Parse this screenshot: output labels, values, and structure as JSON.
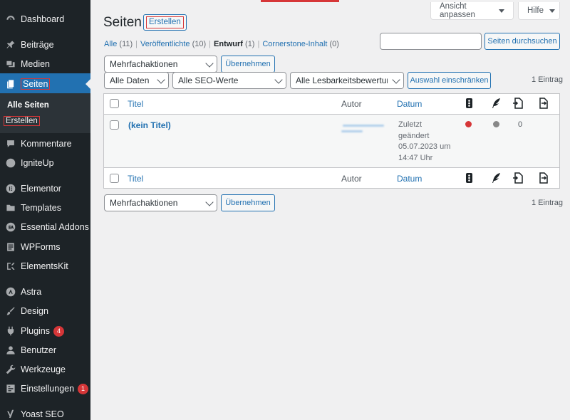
{
  "sidebar": {
    "items": [
      {
        "label": "Dashboard",
        "icon": "dashboard-icon"
      },
      {
        "label": "Beiträge",
        "icon": "pin-icon"
      },
      {
        "label": "Medien",
        "icon": "media-icon"
      },
      {
        "label": "Seiten",
        "icon": "pages-icon"
      },
      {
        "label": "Kommentare",
        "icon": "comment-icon"
      },
      {
        "label": "IgniteUp",
        "icon": "igniteup-icon"
      },
      {
        "label": "Elementor",
        "icon": "elementor-icon"
      },
      {
        "label": "Templates",
        "icon": "folder-icon"
      },
      {
        "label": "Essential Addons",
        "icon": "ea-icon"
      },
      {
        "label": "WPForms",
        "icon": "forms-icon"
      },
      {
        "label": "ElementsKit",
        "icon": "elementskit-icon"
      },
      {
        "label": "Astra",
        "icon": "astra-icon"
      },
      {
        "label": "Design",
        "icon": "brush-icon"
      },
      {
        "label": "Plugins",
        "icon": "plugin-icon",
        "badge": "4"
      },
      {
        "label": "Benutzer",
        "icon": "user-icon"
      },
      {
        "label": "Werkzeuge",
        "icon": "wrench-icon"
      },
      {
        "label": "Einstellungen",
        "icon": "settings-icon",
        "badge": "1"
      },
      {
        "label": "Yoast SEO",
        "icon": "yoast-icon"
      }
    ],
    "submenu": {
      "all_pages": "Alle Seiten",
      "create": "Erstellen"
    }
  },
  "screen_options": {
    "view": "Ansicht anpassen",
    "help": "Hilfe"
  },
  "header": {
    "title": "Seiten",
    "add_new": "Erstellen"
  },
  "views": {
    "all": "Alle",
    "all_count": "(11)",
    "published": "Veröffentlichte",
    "published_count": "(10)",
    "draft": "Entwurf",
    "draft_count": "(1)",
    "cornerstone": "Cornerstone-Inhalt",
    "cornerstone_count": "(0)"
  },
  "search": {
    "button": "Seiten durchsuchen",
    "placeholder": ""
  },
  "bulk": {
    "select": "Mehrfachaktionen",
    "apply": "Übernehmen"
  },
  "filters": {
    "dates": "Alle Daten",
    "seo": "Alle SEO-Werte",
    "readability": "Alle Lesbarkeitsbewertungen",
    "filter_button": "Auswahl einschränken"
  },
  "item_count": "1 Eintrag",
  "table": {
    "columns": {
      "title": "Titel",
      "author": "Autor",
      "date": "Datum"
    },
    "column_icons": [
      "seo-score-icon",
      "readability-icon",
      "outgoing-links-icon",
      "incoming-links-icon"
    ],
    "rows": [
      {
        "title": "(kein Titel)",
        "date_lines": [
          "Zuletzt",
          "geändert",
          "05.07.2023 um",
          "14:47 Uhr"
        ],
        "seo_color": "#d63638",
        "readability_color": "#888888",
        "links": "0"
      }
    ]
  },
  "colors": {
    "accent": "#2271b1",
    "sidebar": "#1d2327",
    "alert": "#d63638"
  }
}
